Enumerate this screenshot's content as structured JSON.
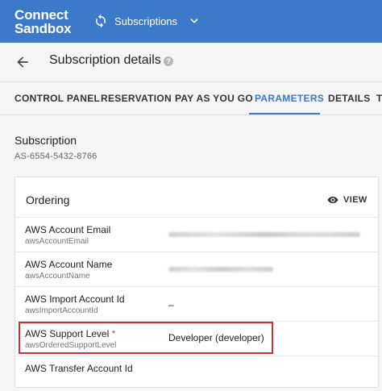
{
  "app": {
    "brand_line1": "Connect",
    "brand_line2": "Sandbox",
    "section": "Subscriptions"
  },
  "header": {
    "title": "Subscription details",
    "help_glyph": "?"
  },
  "tabs": [
    {
      "label": "CONTROL PANEL"
    },
    {
      "label": "RESERVATION"
    },
    {
      "label": "PAY AS YOU GO"
    },
    {
      "label": "PARAMETERS",
      "active": true
    },
    {
      "label": "DETAILS"
    },
    {
      "label": "T"
    }
  ],
  "subscription": {
    "label": "Subscription",
    "id": "AS-6554-5432-8766"
  },
  "ordering": {
    "title": "Ordering",
    "view_label": "VIEW",
    "rows": [
      {
        "label": "AWS Account Email",
        "key": "awsAccountEmail",
        "value": "",
        "redacted": true
      },
      {
        "label": "AWS Account Name",
        "key": "awsAccountName",
        "value": "",
        "redacted": true
      },
      {
        "label": "AWS Import Account Id",
        "key": "awsImportAccountId",
        "value": "–"
      },
      {
        "label": "AWS Support Level",
        "required_mark": "*",
        "key": "awsOrderedSupportLevel",
        "value": "Developer (developer)"
      },
      {
        "label": "AWS Transfer Account Id",
        "key": "",
        "value": ""
      }
    ]
  },
  "colors": {
    "brand": "#3d79c9",
    "highlight": "#d32f2f"
  }
}
